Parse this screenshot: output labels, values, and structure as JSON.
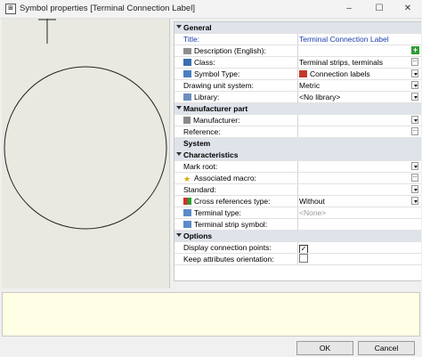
{
  "window": {
    "title": "Symbol properties [Terminal Connection Label]",
    "app_icon": "symbol-window-icon",
    "minimize_glyph": "–",
    "maximize_glyph": "☐",
    "close_glyph": "✕"
  },
  "grid": {
    "categories": {
      "general": "General",
      "manufacturer_part": "Manufacturer part",
      "system": "System",
      "characteristics": "Characteristics",
      "options": "Options"
    },
    "rows": {
      "title": {
        "label": "Title:",
        "value": "Terminal Connection Label"
      },
      "description": {
        "label": "Description (English):",
        "value": ""
      },
      "class": {
        "label": "Class:",
        "value": "Terminal strips, terminals"
      },
      "symbol_type": {
        "label": "Symbol Type:",
        "value": "Connection labels"
      },
      "drawing_unit": {
        "label": "Drawing unit system:",
        "value": "Metric"
      },
      "library": {
        "label": "Library:",
        "value": "<No library>"
      },
      "manufacturer": {
        "label": "Manufacturer:",
        "value": ""
      },
      "reference": {
        "label": "Reference:",
        "value": ""
      },
      "mark_root": {
        "label": "Mark root:",
        "value": ""
      },
      "associated_macro": {
        "label": "Associated macro:",
        "value": ""
      },
      "standard": {
        "label": "Standard:",
        "value": ""
      },
      "cross_references": {
        "label": "Cross references type:",
        "value": "Without"
      },
      "terminal_type": {
        "label": "Terminal type:",
        "value": "<None>"
      },
      "terminal_strip_symbol": {
        "label": "Terminal strip symbol:",
        "value": ""
      },
      "display_connection_points": {
        "label": "Display connection points:",
        "checked": true
      },
      "keep_attributes_orientation": {
        "label": "Keep attributes orientation:",
        "checked": false
      }
    }
  },
  "buttons": {
    "ok": "OK",
    "cancel": "Cancel"
  },
  "colors": {
    "preview_bg": "#e9e9e2",
    "category_bg": "#dfe3ea",
    "description_bg": "#ffffe5",
    "title_value": "#1d3ea8",
    "add_button": "#2e9d32"
  }
}
